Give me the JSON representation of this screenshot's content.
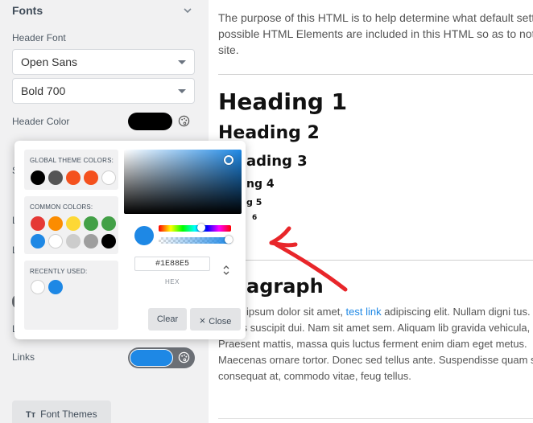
{
  "sidebar": {
    "section_title": "Fonts",
    "header_font_label": "Header Font",
    "header_font_value": "Open Sans",
    "header_weight_value": "Bold 700",
    "header_color_label": "Header Color",
    "header_color_value": "#000000",
    "links_label": "Links",
    "links_color_value": "#1e88e5",
    "font_themes_icon": "Tт",
    "font_themes_label": "Font Themes"
  },
  "color_picker": {
    "global_theme_title": "GLOBAL THEME COLORS:",
    "global_theme_colors": [
      "#000000",
      "#555555",
      "#f4511e",
      "#f4511e",
      "#ffffff"
    ],
    "common_title": "COMMON COLORS:",
    "common_colors": [
      "#e53935",
      "#fb8c00",
      "#fdd835",
      "#43a047",
      "#43a047",
      "#1e88e5",
      "#ffffff",
      "#cccccc",
      "#9e9e9e",
      "#000000"
    ],
    "recent_title": "RECENTLY USED:",
    "recent_colors": [
      "#ffffff",
      "#1e88e5"
    ],
    "current_color": "#1E88E5",
    "hex_value": "#1E88E5",
    "hex_label": "HEX",
    "clear_label": "Clear",
    "close_label": "Close",
    "close_icon": "×"
  },
  "preview": {
    "intro": "The purpose of this HTML is to help determine what default setting possible HTML Elements are included in this HTML so as to not m a site.",
    "h1": "Heading 1",
    "h2": "Heading 2",
    "h3": "ading 3",
    "h4": "ng 4",
    "h5": "g 5",
    "h6": "6",
    "paragraph_heading": "agraph",
    "para_before_link": "ipsum dolor sit amet, ",
    "para_link": "test link",
    "para_after_link": " adipiscing elit. Nullam digni tus. Nunc iaculis suscipit dui. Nam sit amet sem. Aliquam lib gravida vehicula, nisl. Praesent mattis, massa quis luctus ferment enim diam eget metus. Maecenas ornare tortor. Donec sed tellus ante. Suspendisse quam sem, consequat at, commodo vitae, feug tellus."
  },
  "accent_arrow_color": "#e8262a"
}
